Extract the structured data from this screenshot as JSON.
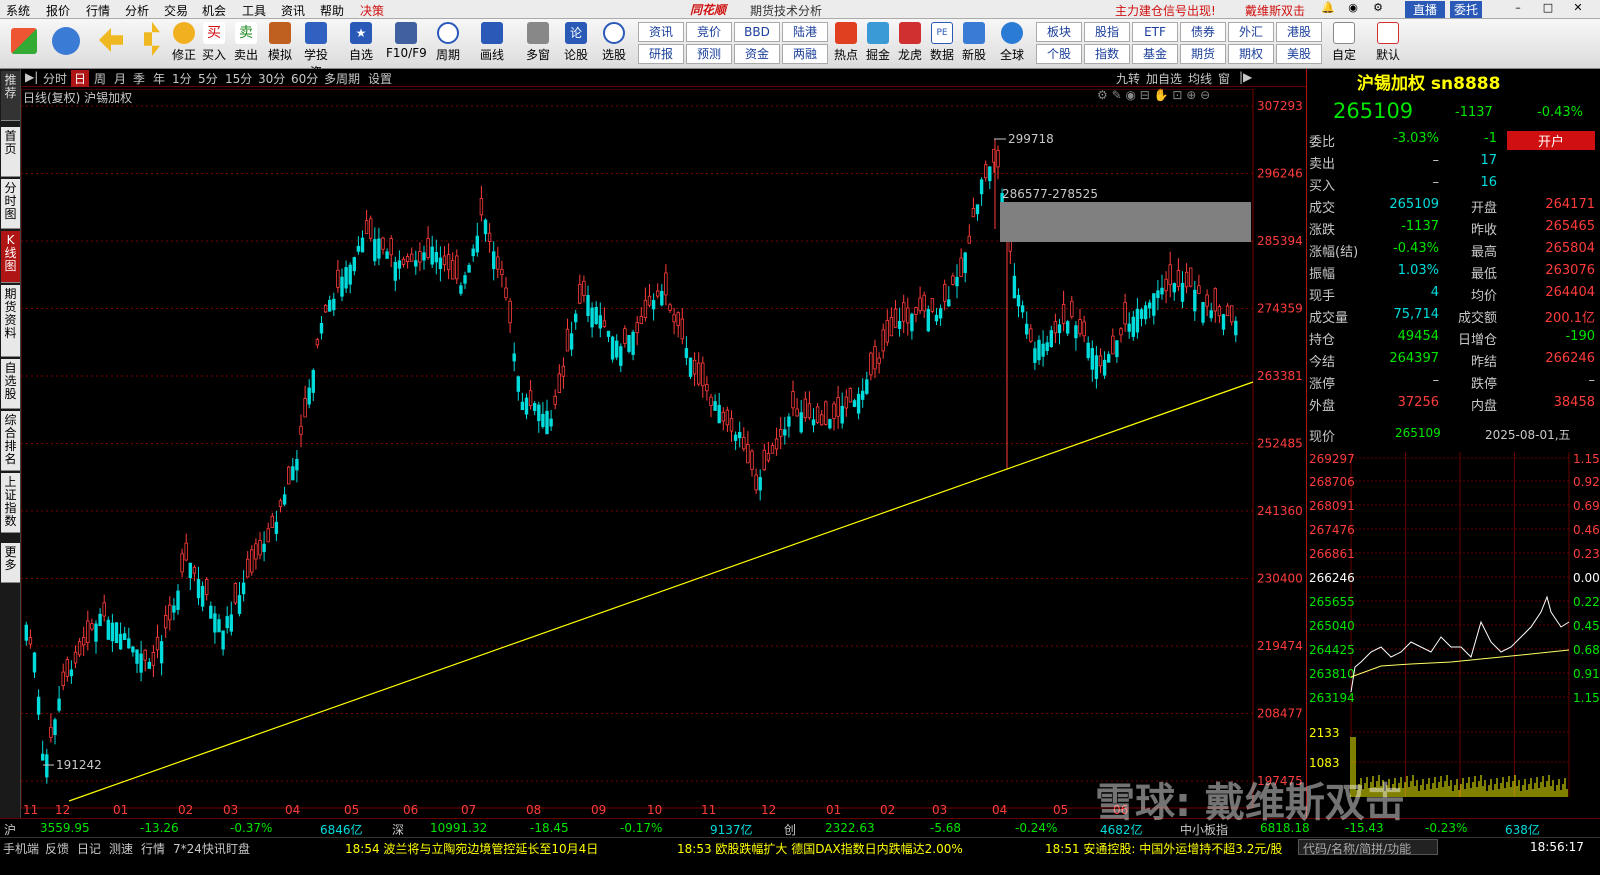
{
  "menubar": {
    "items": [
      "系统",
      "报价",
      "行情",
      "分析",
      "交易",
      "机会",
      "工具",
      "资讯",
      "帮助",
      "决策"
    ],
    "app_name": "同花顺",
    "subtitle": "期货技术分析",
    "alert": "主力建仓信号出现!",
    "alert2": "戴维斯双击",
    "live_label": "直播",
    "order_label": "委托"
  },
  "toolbar": {
    "buttons": [
      "修正",
      "买入",
      "卖出",
      "模拟",
      "学投资",
      "自选",
      "F10/F9",
      "周期",
      "画线",
      "多窗",
      "论股",
      "选股",
      "热点",
      "掘金",
      "龙虎",
      "数据",
      "新股",
      "全球",
      "自定",
      "默认"
    ],
    "grid_buttons": [
      [
        "资讯",
        "竞价",
        "BBD",
        "陆港"
      ],
      [
        "研报",
        "预测",
        "资金",
        "两融"
      ],
      [
        "板块",
        "股指",
        "ETF",
        "债券",
        "外汇",
        "港股"
      ],
      [
        "个股",
        "指数",
        "基金",
        "期货",
        "期权",
        "美股"
      ]
    ]
  },
  "leftnav": [
    "推荐",
    "首页",
    "分时图",
    "K线图",
    "期货资料",
    "自选股",
    "综合排名",
    "上证指数",
    "更多"
  ],
  "periodbar": {
    "items": [
      "分时",
      "日",
      "周",
      "月",
      "季",
      "年",
      "1分",
      "5分",
      "15分",
      "30分",
      "60分",
      "多周期",
      "设置"
    ],
    "active": "日",
    "right_items": [
      "九转",
      "加自选",
      "均线",
      "窗"
    ]
  },
  "chart": {
    "info": "日线(复权) 沪锡加权",
    "price_labels": [
      "307293",
      "296246",
      "285394",
      "274359",
      "263381",
      "252485",
      "241360",
      "230400",
      "219474",
      "208477",
      "197475"
    ],
    "month_labels": [
      "11",
      "12",
      "01",
      "02",
      "03",
      "04",
      "05",
      "06",
      "07",
      "08",
      "09",
      "10",
      "11",
      "12",
      "01",
      "02",
      "03",
      "04",
      "05",
      "06"
    ],
    "annotations": {
      "high": "299718",
      "low": "191242",
      "gap": "286577-278525"
    },
    "colors": {
      "up": "#ff3c3c",
      "down": "#00dcdc",
      "trend": "#ffff00",
      "grid": "#7a0000"
    }
  },
  "chart_data": {
    "type": "candlestick",
    "title": "日线(复权) 沪锡加权",
    "ylim": [
      191242,
      307293
    ],
    "x_ticks": [
      "11",
      "12",
      "01",
      "02",
      "03",
      "04",
      "05",
      "06",
      "07",
      "08",
      "09",
      "10",
      "11",
      "12",
      "01",
      "02",
      "03",
      "04",
      "05",
      "06"
    ],
    "keypoints": [
      {
        "label": "low",
        "value": 191242
      },
      {
        "label": "high",
        "value": 299718
      },
      {
        "label": "gap",
        "value": "286577-278525"
      },
      {
        "label": "last",
        "value": 265109
      }
    ]
  },
  "quote": {
    "title": "沪锡加权 sn8888",
    "price": "265109",
    "change": "-1137",
    "pct": "-0.43%",
    "rows": [
      [
        "委比",
        "-3.03%",
        "-1",
        "开户"
      ],
      [
        "卖出",
        "–",
        "17",
        ""
      ],
      [
        "买入",
        "–",
        "16",
        ""
      ],
      [
        "成交",
        "265109",
        "开盘",
        "264171"
      ],
      [
        "涨跌",
        "-1137",
        "昨收",
        "265465"
      ],
      [
        "涨幅(结)",
        "-0.43%",
        "最高",
        "265804"
      ],
      [
        "振幅",
        "1.03%",
        "最低",
        "263076"
      ],
      [
        "现手",
        "4",
        "均价",
        "264404"
      ],
      [
        "成交量",
        "75,714",
        "成交额",
        "200.1亿"
      ],
      [
        "持仓",
        "49454",
        "日增仓",
        "-190"
      ],
      [
        "今结",
        "264397",
        "昨结",
        "266246"
      ],
      [
        "涨停",
        "–",
        "跌停",
        "–"
      ],
      [
        "外盘",
        "37256",
        "内盘",
        "38458"
      ]
    ],
    "now_label": "现价",
    "now_price": "265109",
    "date": "2025-08-01,五"
  },
  "intraday": {
    "price_labels": [
      "269297",
      "268706",
      "268091",
      "267476",
      "266861",
      "266246",
      "265655",
      "265040",
      "264425",
      "263810",
      "263194",
      "2133",
      "1083"
    ],
    "pct_labels": [
      "1.15%",
      "0.92%",
      "0.69%",
      "0.46%",
      "0.23%",
      "0.00%",
      "0.22%",
      "0.45%",
      "0.68%",
      "0.91%",
      "1.15%"
    ]
  },
  "bottombar": {
    "items": [
      [
        "沪",
        "3559.95",
        "-13.26",
        "-0.37%",
        "6846亿"
      ],
      [
        "深",
        "10991.32",
        "-18.45",
        "-0.17%",
        "9137亿"
      ],
      [
        "创",
        "2322.63",
        "-5.68",
        "-0.24%",
        "4682亿"
      ],
      [
        "中小板指",
        "6818.18",
        "-15.43",
        "-0.23%",
        "638亿"
      ]
    ]
  },
  "newsbar": {
    "left_items": [
      "手机端",
      "反馈",
      "日记",
      "测速",
      "行情",
      "7*24快讯",
      "盯盘"
    ],
    "news": [
      "18:54 波兰将与立陶宛边境管控延长至10月4日",
      "18:53 欧股跌幅扩大 德国DAX指数日内跌幅达2.00%",
      "18:51 安通控股: 中国外运增持不超3.2元/股"
    ],
    "search": "代码/名称/简拼/功能",
    "time": "18:56:17"
  },
  "watermark": "雪球: 戴维斯双击"
}
